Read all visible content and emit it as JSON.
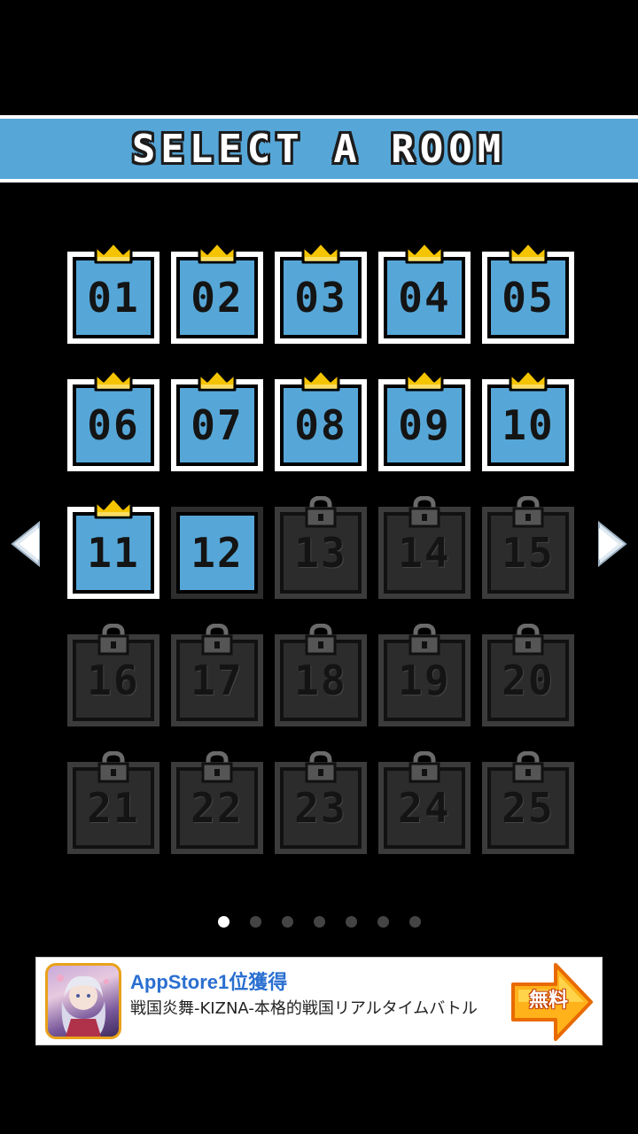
{
  "header": {
    "title": "SELECT A ROOM"
  },
  "rooms": [
    {
      "label": "01",
      "state": "cleared"
    },
    {
      "label": "02",
      "state": "cleared"
    },
    {
      "label": "03",
      "state": "cleared"
    },
    {
      "label": "04",
      "state": "cleared"
    },
    {
      "label": "05",
      "state": "cleared"
    },
    {
      "label": "06",
      "state": "cleared"
    },
    {
      "label": "07",
      "state": "cleared"
    },
    {
      "label": "08",
      "state": "cleared"
    },
    {
      "label": "09",
      "state": "cleared"
    },
    {
      "label": "10",
      "state": "cleared"
    },
    {
      "label": "11",
      "state": "cleared"
    },
    {
      "label": "12",
      "state": "open"
    },
    {
      "label": "13",
      "state": "locked"
    },
    {
      "label": "14",
      "state": "locked"
    },
    {
      "label": "15",
      "state": "locked"
    },
    {
      "label": "16",
      "state": "locked"
    },
    {
      "label": "17",
      "state": "locked"
    },
    {
      "label": "18",
      "state": "locked"
    },
    {
      "label": "19",
      "state": "locked"
    },
    {
      "label": "20",
      "state": "locked"
    },
    {
      "label": "21",
      "state": "locked"
    },
    {
      "label": "22",
      "state": "locked"
    },
    {
      "label": "23",
      "state": "locked"
    },
    {
      "label": "24",
      "state": "locked"
    },
    {
      "label": "25",
      "state": "locked"
    }
  ],
  "navigation": {
    "prev_icon": "left-arrow-icon",
    "next_icon": "right-arrow-icon"
  },
  "pagination": {
    "total_pages": 7,
    "current_page": 1
  },
  "ad": {
    "title": "AppStore1位獲得",
    "description": "戦国炎舞-KIZNA-本格的戦国リアルタイムバトル",
    "cta_label": "無料",
    "icon": "game-character-icon"
  },
  "colors": {
    "accent": "#56a7d8",
    "crown": "#f5c400",
    "locked_tile": "#2c2c2c",
    "background": "#000000"
  }
}
